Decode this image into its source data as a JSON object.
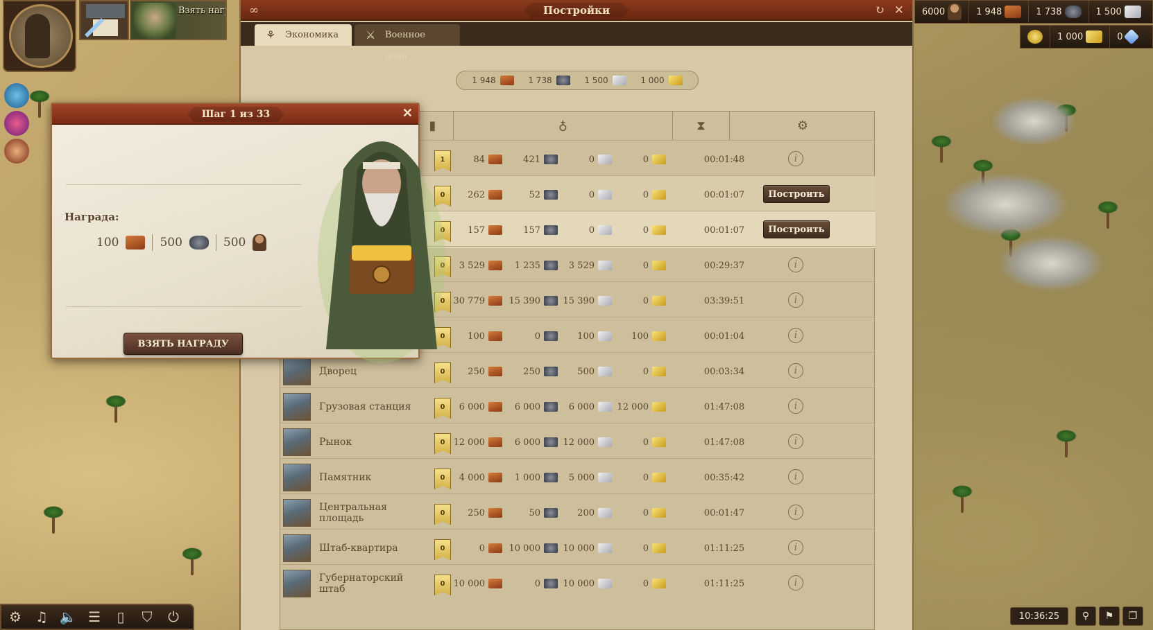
{
  "hud": {
    "quest_notice": "Взять награ",
    "clock": "10:36:25"
  },
  "resources_top": [
    {
      "value": "6000",
      "icon": "worker-icon"
    },
    {
      "value": "1 948",
      "icon": "wood-icon"
    },
    {
      "value": "1 738",
      "icon": "stone-icon"
    },
    {
      "value": "1 500",
      "icon": "marble-icon"
    }
  ],
  "resources_second": [
    {
      "value": "1 000",
      "icon": "gold-icon"
    },
    {
      "value": "0",
      "icon": "diamond-icon"
    }
  ],
  "panel": {
    "title": "Постройки",
    "tabs": [
      {
        "label": "Экономика",
        "active": true
      },
      {
        "label": "Военное дело",
        "active": false
      }
    ],
    "summary": {
      "wood": "1 948",
      "stone": "1 738",
      "marble": "1 500",
      "gold": "1 000"
    },
    "build_label": "Построить",
    "rows": [
      {
        "name": "",
        "level": "1",
        "wood": "84",
        "stone": "421",
        "marble": "0",
        "gold": "0",
        "time": "00:01:48",
        "action": "info"
      },
      {
        "name": "",
        "level": "0",
        "wood": "262",
        "stone": "52",
        "marble": "0",
        "gold": "0",
        "time": "00:01:07",
        "action": "build"
      },
      {
        "name": "",
        "level": "0",
        "wood": "157",
        "stone": "157",
        "marble": "0",
        "gold": "0",
        "time": "00:01:07",
        "action": "build"
      },
      {
        "name": "",
        "level": "0",
        "wood": "3 529",
        "stone": "1 235",
        "marble": "3 529",
        "gold": "0",
        "time": "00:29:37",
        "action": "info"
      },
      {
        "name": "",
        "level": "0",
        "wood": "30 779",
        "stone": "15 390",
        "marble": "15 390",
        "gold": "0",
        "time": "03:39:51",
        "action": "info"
      },
      {
        "name": "",
        "level": "0",
        "wood": "100",
        "stone": "0",
        "marble": "100",
        "gold": "100",
        "time": "00:01:04",
        "action": "info"
      },
      {
        "name": "Дворец",
        "level": "0",
        "wood": "250",
        "stone": "250",
        "marble": "500",
        "gold": "0",
        "time": "00:03:34",
        "action": "info"
      },
      {
        "name": "Грузовая станция",
        "level": "0",
        "wood": "6 000",
        "stone": "6 000",
        "marble": "6 000",
        "gold": "12 000",
        "time": "01:47:08",
        "action": "info"
      },
      {
        "name": "Рынок",
        "level": "0",
        "wood": "12 000",
        "stone": "6 000",
        "marble": "12 000",
        "gold": "0",
        "time": "01:47:08",
        "action": "info"
      },
      {
        "name": "Памятник",
        "level": "0",
        "wood": "4 000",
        "stone": "1 000",
        "marble": "5 000",
        "gold": "0",
        "time": "00:35:42",
        "action": "info"
      },
      {
        "name": "Центральная площадь",
        "level": "0",
        "wood": "250",
        "stone": "50",
        "marble": "200",
        "gold": "0",
        "time": "00:01:47",
        "action": "info"
      },
      {
        "name": "Штаб-квартира",
        "level": "0",
        "wood": "0",
        "stone": "10 000",
        "marble": "10 000",
        "gold": "0",
        "time": "01:11:25",
        "action": "info"
      },
      {
        "name": "Губернаторский штаб",
        "level": "0",
        "wood": "10 000",
        "stone": "0",
        "marble": "10 000",
        "gold": "0",
        "time": "01:11:25",
        "action": "info"
      }
    ]
  },
  "quest": {
    "title": "Шаг 1 из 33",
    "reward_label": "Награда:",
    "rewards": [
      {
        "value": "100",
        "icon": "wood-icon"
      },
      {
        "value": "500",
        "icon": "stone-icon"
      },
      {
        "value": "500",
        "icon": "worker-icon"
      }
    ],
    "button_label": "ВЗЯТЬ НАГРАДУ"
  },
  "colors": {
    "header_red": "#7a2c15",
    "parchment": "#d7c9a6",
    "button_dark": "#3e2b1e",
    "level_flag": "#f5e089"
  }
}
